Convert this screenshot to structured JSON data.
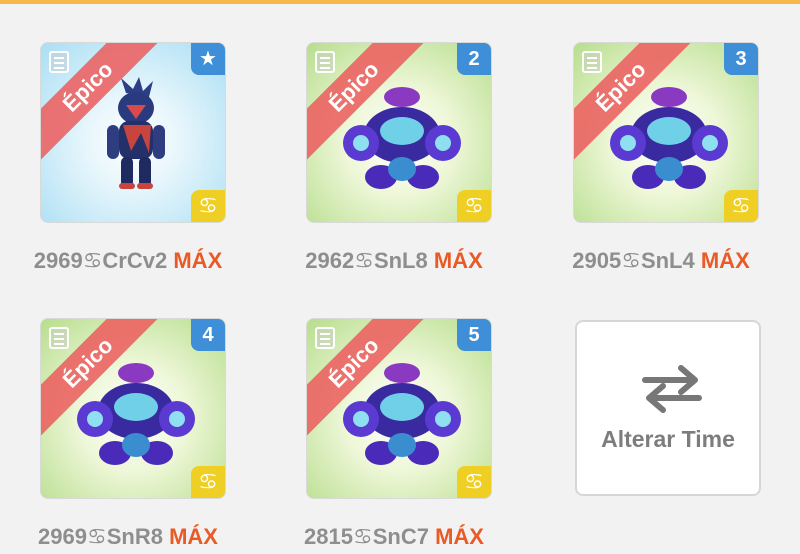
{
  "team": {
    "cards": [
      {
        "rarity": "Épico",
        "badge": "★",
        "name": "2969",
        "sign": "♋",
        "code": "CrCv2",
        "level": "MÁX",
        "background": "blue",
        "creature": "werewolf"
      },
      {
        "rarity": "Épico",
        "badge": "2",
        "name": "2962",
        "sign": "♋",
        "code": "SnL8",
        "level": "MÁX",
        "background": "green",
        "creature": "crab"
      },
      {
        "rarity": "Épico",
        "badge": "3",
        "name": "2905",
        "sign": "♋",
        "code": "SnL4",
        "level": "MÁX",
        "background": "green",
        "creature": "crab"
      },
      {
        "rarity": "Épico",
        "badge": "4",
        "name": "2969",
        "sign": "♋",
        "code": "SnR8",
        "level": "MÁX",
        "background": "green",
        "creature": "crab"
      },
      {
        "rarity": "Épico",
        "badge": "5",
        "name": "2815",
        "sign": "♋",
        "code": "SnC7",
        "level": "MÁX",
        "background": "green",
        "creature": "crab"
      }
    ],
    "swap_button": {
      "label": "Alterar Time",
      "icon": "swap-arrows-icon"
    }
  },
  "colors": {
    "accent": "#f5b94a",
    "epic_ribbon": "#ec6060",
    "slot_badge": "#3f8fd8",
    "zodiac_badge": "#f0cf25",
    "max_text": "#ea5a26"
  }
}
